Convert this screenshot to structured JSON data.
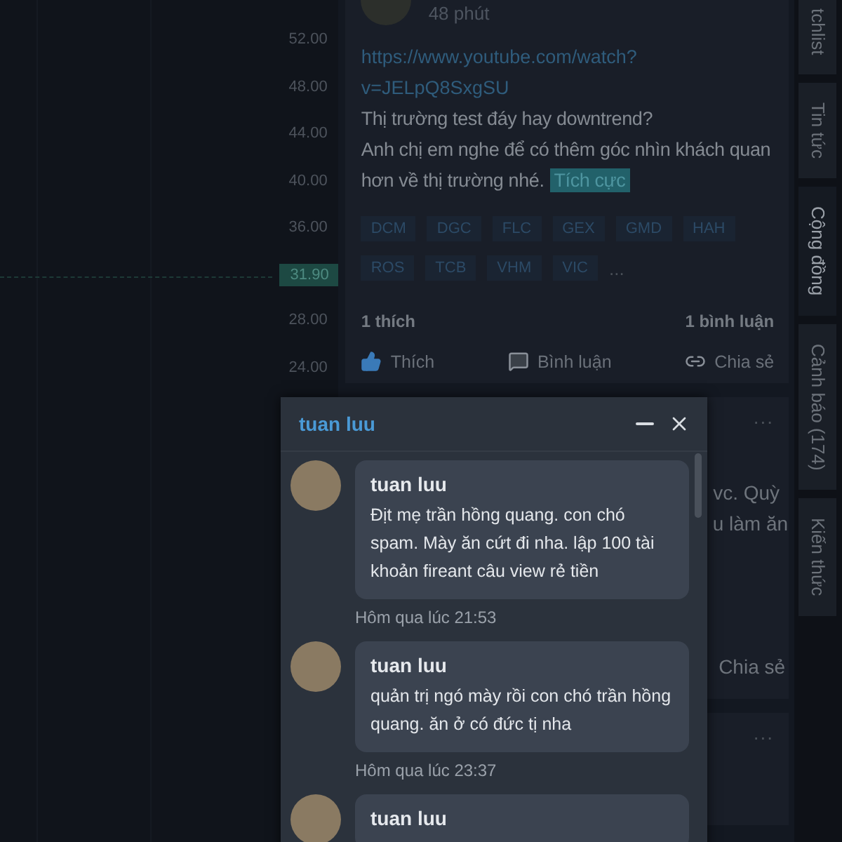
{
  "price_axis": {
    "labels": [
      "52.00",
      "48.00",
      "44.00",
      "40.00",
      "36.00",
      "28.00",
      "24.00"
    ],
    "current_price": "31.90"
  },
  "feed": {
    "post": {
      "time": "48 phút",
      "link": "https://www.youtube.com/watch?v=JELpQ8SxgSU",
      "lines": [
        "Thị trường test đáy hay downtrend?",
        "Anh chị em nghe để có thêm góc nhìn khách quan hơn về thị trường nhé."
      ],
      "sentiment": "Tích cực",
      "tags": [
        "DCM",
        "DGC",
        "FLC",
        "GEX",
        "GMD",
        "HAH",
        "ROS",
        "TCB",
        "VHM",
        "VIC"
      ],
      "more_tags": "...",
      "likes": "1 thích",
      "comments": "1 bình luận",
      "actions": [
        {
          "kind": "like",
          "label": "Thích"
        },
        {
          "kind": "comment",
          "label": "Bình luận"
        },
        {
          "kind": "share",
          "label": "Chia sẻ"
        }
      ]
    },
    "post_2": {
      "more": "...",
      "lines": [
        "vc. Quỳ",
        "u làm ăn"
      ],
      "share": "Chia sẻ"
    },
    "post_3": {
      "more": "..."
    }
  },
  "side_tabs": [
    {
      "label": "tchlist",
      "selected": false
    },
    {
      "label": "Tin tức",
      "selected": false
    },
    {
      "label": "Cộng đồng",
      "selected": true
    },
    {
      "label": "Cảnh báo (174)",
      "selected": false
    },
    {
      "label": "Kiến thức",
      "selected": false
    }
  ],
  "chat": {
    "title": "tuan luu",
    "messages": [
      {
        "sender": "tuan luu",
        "text": "Địt mẹ trần hồng quang. con chó spam. Mày ăn cứt đi nha. lập 100 tài khoản fireant câu view rẻ tiền",
        "time": "Hôm qua lúc 21:53"
      },
      {
        "sender": "tuan luu",
        "text": "quản trị ngó mày rồi con chó trần hồng quang. ăn ở có đức tị nha",
        "time": "Hôm qua lúc 23:37"
      },
      {
        "sender": "tuan luu"
      }
    ]
  }
}
